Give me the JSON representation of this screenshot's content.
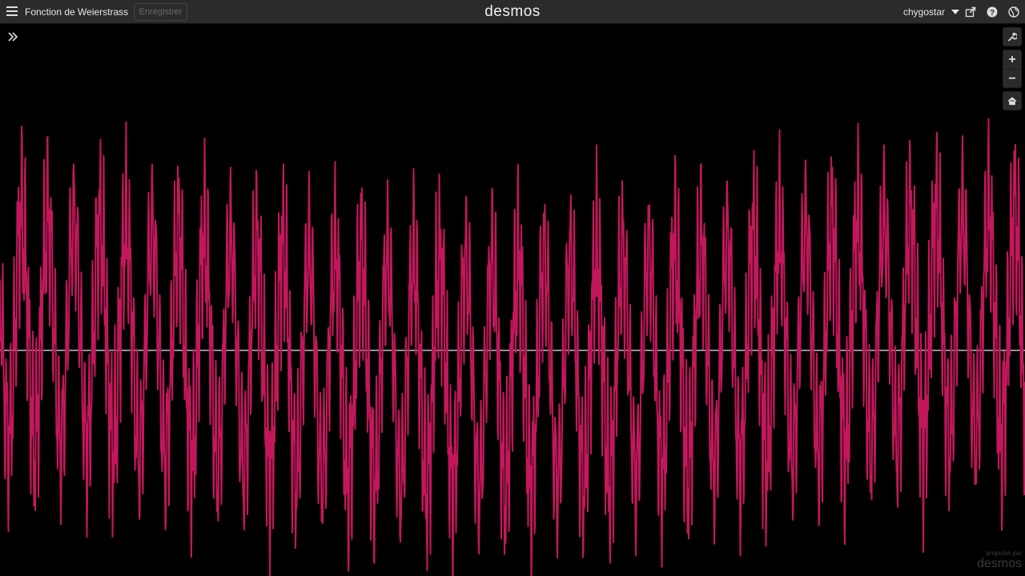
{
  "header": {
    "menu_icon": "hamburger-menu-icon",
    "graph_title": "Fonction de Weierstrass",
    "save_label": "Enregistrer",
    "logo": "desmos",
    "user_name": "chygostar",
    "icons": [
      "share-icon",
      "help-icon",
      "language-globe-icon"
    ]
  },
  "graph_controls": {
    "expression_toggle_icon": "expand-expressions-icon",
    "settings_icon": "wrench-icon",
    "zoom_in": "+",
    "zoom_out": "−",
    "home_icon": "home-icon"
  },
  "watermark": {
    "small_text": "propulsé par",
    "logo": "desmos"
  },
  "colors": {
    "curve": "#c2185b",
    "axis": "#e6e6e6",
    "background": "#000000",
    "topbar": "#2b2b2b"
  },
  "chart_data": {
    "type": "line",
    "function": "weierstrass",
    "y_axis_visible": false,
    "x_axis_visible": true,
    "grid": false
  }
}
